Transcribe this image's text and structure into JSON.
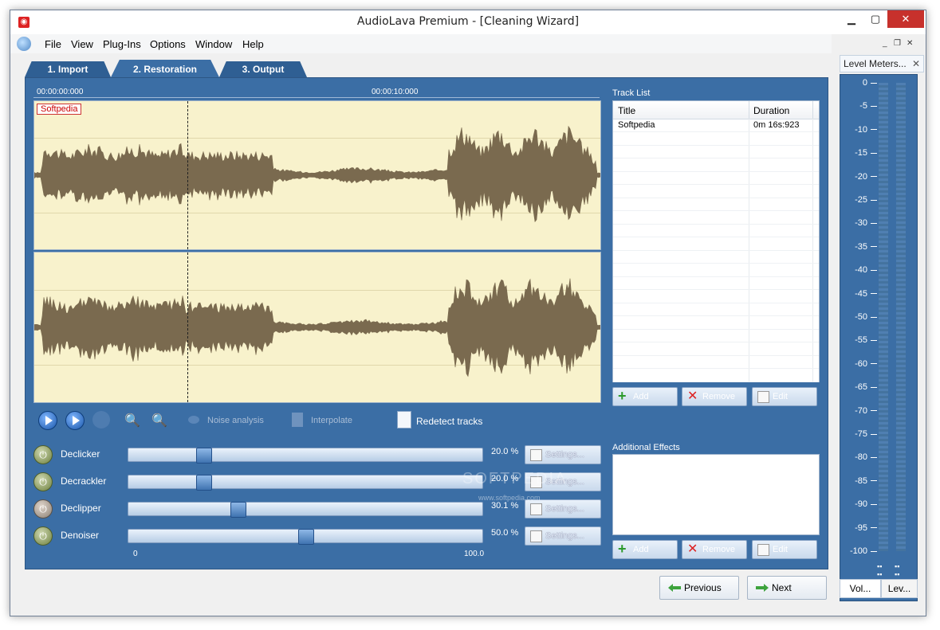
{
  "window": {
    "title": "AudioLava Premium - [Cleaning Wizard]",
    "controls": {
      "minimize": "▁",
      "maximize": "▢",
      "close": "✕"
    }
  },
  "menu": {
    "items": [
      {
        "label": "File"
      },
      {
        "label": "View"
      },
      {
        "label": "Plug-Ins"
      },
      {
        "label": "Options"
      },
      {
        "label": "Window"
      },
      {
        "label": "Help"
      }
    ],
    "mdi_controls": {
      "minimize": "_",
      "restore": "❐",
      "close": "✕"
    }
  },
  "tabs": [
    {
      "label": "1. Import"
    },
    {
      "label": "2. Restoration"
    },
    {
      "label": "3. Output"
    }
  ],
  "waveform": {
    "time_start": "00:00:00:000",
    "time_mid": "00:00:10:000",
    "track_tag": "Softpedia",
    "wave_color": "#7a6a4f",
    "background_color": "#f8f2cc"
  },
  "playback": {
    "play_icon": "play-icon",
    "play_selection_icon": "play-selection-icon",
    "stop_icon": "stop-icon",
    "zoom_in_icon": "zoom-in-icon",
    "zoom_out_icon": "zoom-out-icon",
    "noise_analysis": "Noise analysis",
    "interpolate": "Interpolate",
    "redetect": "Redetect tracks"
  },
  "effects": [
    {
      "name": "Declicker",
      "value": 0.2,
      "display": "20.0 %",
      "on": true
    },
    {
      "name": "Decrackler",
      "value": 0.2,
      "display": "20.0 %",
      "on": true
    },
    {
      "name": "Declipper",
      "value": 0.301,
      "display": "30.1 %",
      "on": false
    },
    {
      "name": "Denoiser",
      "value": 0.5,
      "display": "50.0 %",
      "on": true
    }
  ],
  "slider_scale": {
    "min": "0",
    "max": "100.0"
  },
  "settings_label": "Settings...",
  "track_list": {
    "title": "Track List",
    "columns": [
      "Title",
      "Duration"
    ],
    "rows": [
      {
        "title": "Softpedia",
        "duration": "0m 16s:923"
      }
    ]
  },
  "track_buttons": {
    "add": "Add",
    "remove": "Remove",
    "edit": "Edit"
  },
  "additional_effects": {
    "title": "Additional Effects",
    "buttons": {
      "add": "Add",
      "remove": "Remove",
      "edit": "Edit"
    }
  },
  "navigation": {
    "previous": "Previous",
    "next": "Next"
  },
  "level_meters": {
    "title": "Level Meters...",
    "ticks": [
      "0",
      "-5",
      "-10",
      "-15",
      "-20",
      "-25",
      "-30",
      "-35",
      "-40",
      "-45",
      "-50",
      "-55",
      "-60",
      "-65",
      "-70",
      "-75",
      "-80",
      "-85",
      "-90",
      "-95",
      "-100"
    ],
    "bottom_tabs": [
      "Vol...",
      "Lev..."
    ]
  },
  "watermark": {
    "main": "SOFTPEDIA",
    "url": "www.softpedia.com"
  }
}
